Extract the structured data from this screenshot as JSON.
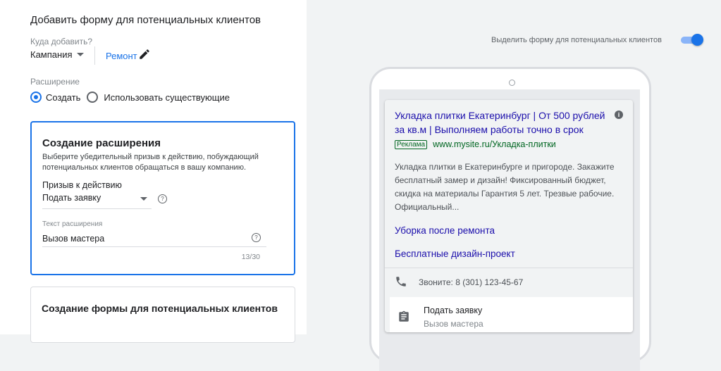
{
  "form": {
    "title": "Добавить форму для потенциальных клиентов",
    "where_label": "Куда добавить?",
    "campaign_type": "Кампания",
    "campaign_name": "Ремонт",
    "extension_label": "Расширение",
    "options": [
      "Создать",
      "Использовать существующие"
    ],
    "selected_option": "Создать"
  },
  "extension_card": {
    "title": "Создание расширения",
    "description": "Выберите убедительный призыв к действию, побуждающий потенциальных клиентов обращаться в вашу компанию.",
    "cta_label": "Призыв к действию",
    "cta_value": "Подать заявку",
    "text_label": "Текст расширения",
    "text_value": "Вызов мастера",
    "counter": "13/30"
  },
  "form_card": {
    "title": "Создание формы для потенциальных клиентов"
  },
  "preview": {
    "toggle_label": "Выделить форму для потенциальных клиентов",
    "toggle_on": true,
    "ad_title": "Укладка плитки Екатеринбург | От 500 рублей за кв.м | Выполняем работы точно в срок",
    "ad_badge": "Реклама",
    "ad_url": "www.mysite.ru/Укладка-плитки",
    "ad_description": "Укладка плитки в Екатеринбурге и пригороде. Закажите бесплатный замер и дизайн! Фиксированный бюджет, скидка на материалы Гарантия 5 лет. Трезвые рабочие. Официальный...",
    "sitelinks": [
      "Уборка после ремонта",
      "Бесплатные дизайн-проект"
    ],
    "call_text": "Звоните: 8 (301) 123-45-67",
    "lead_title": "Подать заявку",
    "lead_subtitle": "Вызов мастера"
  },
  "icons": {
    "edit": "pencil-icon",
    "help": "help-icon",
    "info": "info-icon",
    "phone": "phone-icon",
    "lead": "clipboard-icon",
    "dropdown": "chevron-down-icon"
  },
  "colors": {
    "accent": "#1a73e8",
    "link": "#1a0dab",
    "ad_green": "#006621"
  }
}
